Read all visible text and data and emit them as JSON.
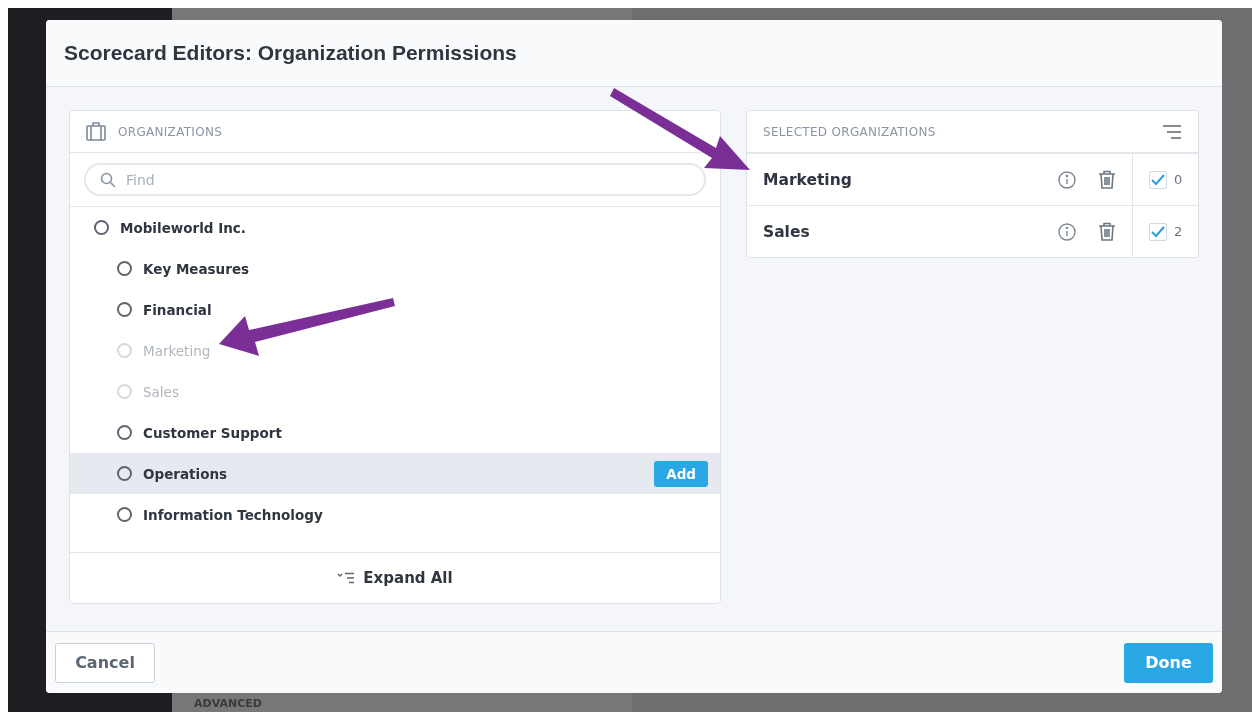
{
  "background": {
    "section_label": "ADVANCED"
  },
  "dialog": {
    "title": "Scorecard Editors: Organization Permissions"
  },
  "organizations": {
    "header": "ORGANIZATIONS",
    "search": {
      "placeholder": "Find"
    },
    "tree": [
      {
        "label": "Mobileworld Inc.",
        "disabled": false,
        "selected": false,
        "children": [
          {
            "label": "Key Measures",
            "disabled": false,
            "selected": false
          },
          {
            "label": "Financial",
            "disabled": false,
            "selected": false
          },
          {
            "label": "Marketing",
            "disabled": true,
            "selected": false
          },
          {
            "label": "Sales",
            "disabled": true,
            "selected": false
          },
          {
            "label": "Customer Support",
            "disabled": false,
            "selected": false
          },
          {
            "label": "Operations",
            "disabled": false,
            "selected": true,
            "action": "Add"
          },
          {
            "label": "Information Technology",
            "disabled": false,
            "selected": false
          }
        ]
      }
    ],
    "expand_all": "Expand All"
  },
  "selected_organizations": {
    "header": "SELECTED ORGANIZATIONS",
    "rows": [
      {
        "name": "Marketing",
        "checked": true,
        "count": "0"
      },
      {
        "name": "Sales",
        "checked": true,
        "count": "2"
      }
    ]
  },
  "buttons": {
    "cancel": "Cancel",
    "done": "Done"
  }
}
